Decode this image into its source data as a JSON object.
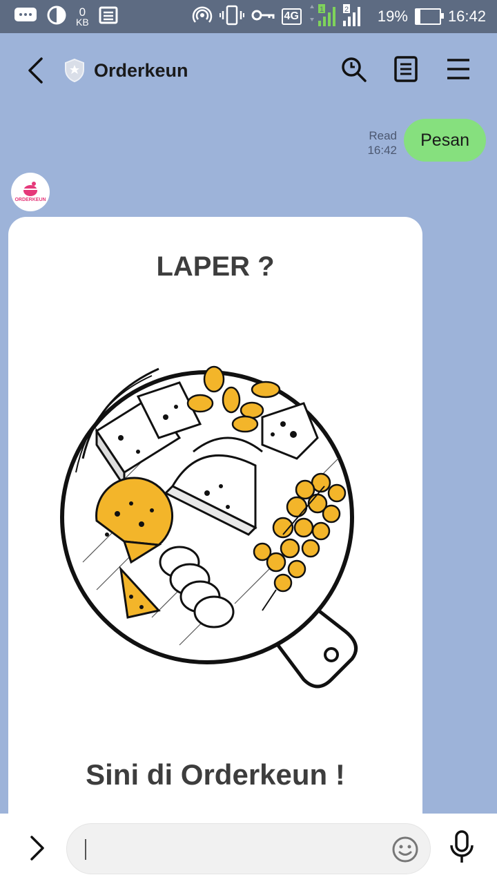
{
  "status_bar": {
    "data_speed_value": "0",
    "data_speed_unit": "KB",
    "network_type": "4G",
    "sim1": "1",
    "sim2": "2",
    "battery_percent": "19%",
    "battery_level": 0.19,
    "time": "16:42",
    "icons": [
      "chat-notification-icon",
      "half-circle-icon",
      "news-icon",
      "hotspot-icon",
      "vibrate-icon",
      "vpn-key-icon",
      "signal-icon",
      "battery-icon"
    ]
  },
  "header": {
    "title": "Orderkeun",
    "icons": [
      "back-icon",
      "shield-icon",
      "search-icon",
      "notes-icon",
      "menu-icon"
    ]
  },
  "chat": {
    "sent_message": {
      "text": "Pesan",
      "status": "Read",
      "time": "16:42",
      "color": "#86e07e"
    },
    "sender_avatar_label": "ORDERKEUN",
    "card": {
      "title": "LAPER ?",
      "subtitle": "Sini di Orderkeun !"
    }
  },
  "input_bar": {
    "value": "",
    "icons": [
      "expand-icon",
      "emoji-icon",
      "mic-icon"
    ]
  },
  "colors": {
    "status_bar": "#5d6b82",
    "chat_background": "#9db3d9",
    "sent_bubble": "#86e07e",
    "food_accent": "#f3b52a"
  }
}
